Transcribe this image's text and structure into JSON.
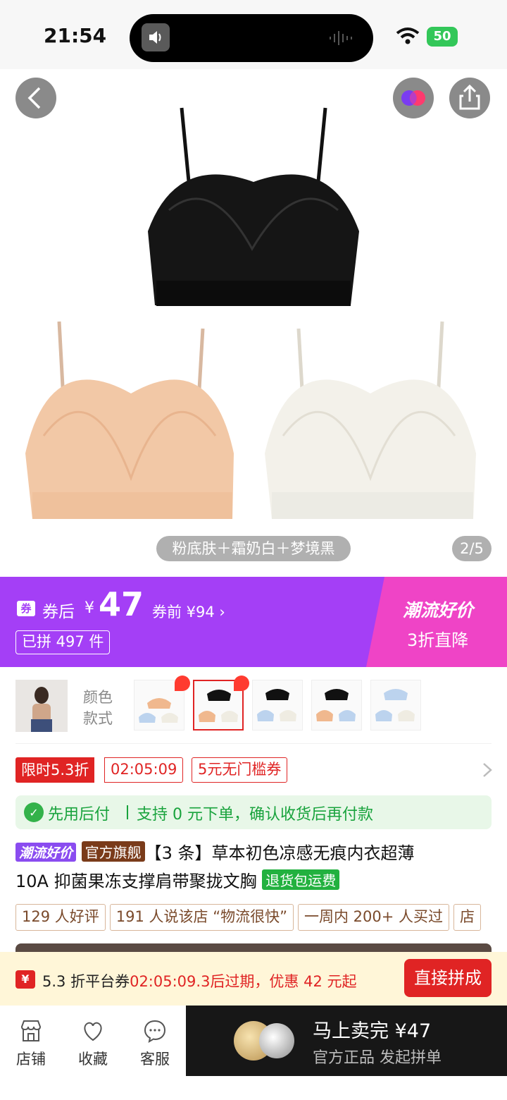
{
  "status_bar": {
    "time": "21:54",
    "battery": "50"
  },
  "hero": {
    "caption": "粉底肤＋霜奶白＋梦境黑",
    "page_indicator": "2/5"
  },
  "price_banner": {
    "after_label": "券后",
    "currency": "¥",
    "price": "47",
    "before_price": "券前 ¥94 ›",
    "sold": "已拼 497 件",
    "promo_title": "潮流好价",
    "promo_sub": "3折直降",
    "coupon_icon": "券"
  },
  "variants": {
    "label_line1": "颜色",
    "label_line2": "款式"
  },
  "limited": {
    "tag": "限时5.3折",
    "countdown": "02:05:09",
    "coupon": "5元无门槛券"
  },
  "paylater": {
    "title": "先用后付",
    "desc": "支持 0 元下单，确认收货后再付款"
  },
  "title": {
    "badge_trend": "潮流好价",
    "badge_official": "官方旗舰",
    "line1_text": "【3 条】草本初色凉感无痕内衣超薄",
    "line2_text": "10A 抑菌果冻支撑肩带聚拢文胸",
    "badge_return": "退货包运费"
  },
  "chips": [
    "129 人好评",
    "191 人说该店 “物流很快”",
    "一周内 200+ 人买过",
    "店"
  ],
  "expiry": {
    "icon": "¥",
    "prefix": "5.3 折平台券",
    "countdown": "02:05:09.3",
    "suffix": "后过期，优惠 42 元起",
    "button": "直接拼成"
  },
  "bottom_nav": {
    "store": "店铺",
    "favorite": "收藏",
    "service": "客服"
  },
  "buy_bar": {
    "title": "马上卖完 ¥47",
    "subtitle": "官方正品 发起拼单"
  }
}
